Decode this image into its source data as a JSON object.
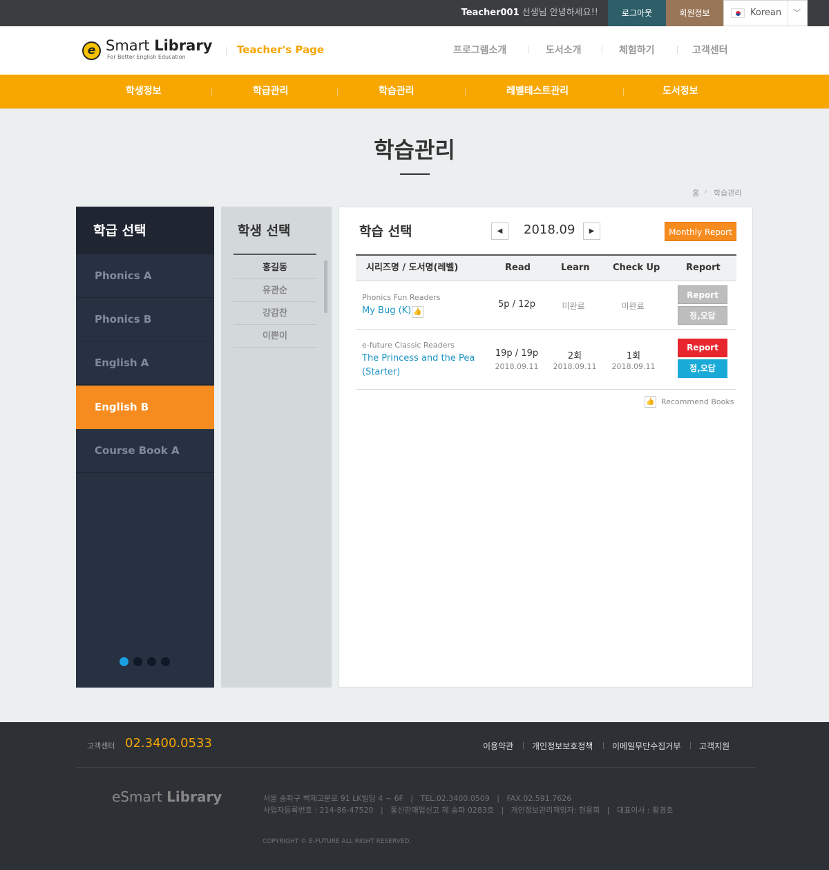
{
  "topbar": {
    "greeting_name": "Teacher001",
    "greeting_suffix": " 선생님 안녕하세요!!",
    "logout": "로그아웃",
    "member_info": "회원정보",
    "language": "Korean"
  },
  "header": {
    "logo_prefix": "Smart",
    "logo_bold": "Library",
    "logo_sub": "For Better English Education",
    "page_label": "Teacher's Page",
    "nav": [
      "프로그램소개",
      "도서소개",
      "체험하기",
      "고객센터"
    ]
  },
  "main_nav": [
    "학생정보",
    "학급관리",
    "학습관리",
    "레벨테스트관리",
    "도서정보"
  ],
  "page": {
    "title": "학습관리",
    "breadcrumb_home": "홈",
    "breadcrumb_current": "학습관리"
  },
  "class_panel": {
    "title": "학급 선택",
    "items": [
      "Phonics A",
      "Phonics B",
      "English A",
      "English B",
      "Course Book A"
    ],
    "active_index": 3,
    "pages": 4,
    "current_page": 1
  },
  "student_panel": {
    "title": "학생 선택",
    "students": [
      "홍길동",
      "유관순",
      "강감찬",
      "이쁜이"
    ],
    "selected_index": 0
  },
  "study_panel": {
    "title": "학습 선택",
    "month": "2018.09",
    "monthly_report": "Monthly Report",
    "headers": [
      "시리즈명 / 도서명(레벨)",
      "Read",
      "Learn",
      "Check Up",
      "Report"
    ],
    "rows": [
      {
        "series": "Phonics Fun Readers",
        "book": "My Bug (K)",
        "read": "5p / 12p",
        "learn": "미완료",
        "check": "미완료",
        "report": "Report",
        "answer": "정,오답"
      },
      {
        "series": "e-future Classic Readers",
        "book_line1": "The Princess and the Pea",
        "book_line2": "(Starter)",
        "read": "19p / 19p",
        "read_date": "2018.09.11",
        "learn": "2회",
        "learn_date": "2018.09.11",
        "check": "1회",
        "check_date": "2018.09.11",
        "report": "Report",
        "answer": "정,오답"
      }
    ],
    "recommend": "Recommend Books"
  },
  "footer": {
    "cs_label": "고객센터",
    "cs_phone": "02.3400.0533",
    "links": [
      "이용약관",
      "개인정보보호정책",
      "이메일무단수집거부",
      "고객지원"
    ],
    "logo_prefix": "eSmart",
    "logo_bold": "Library",
    "info_line1": "서울 송파구 백제고분로 91 LK빌딩 4 ~ 6F   |   TEL.02.3400.0509   |   FAX.02.591.7626",
    "info_line2": "사업자등록번호 : 214-86-47520   |   통신판매업신고 제 송파 0283호   |   개인정보관리책임자: 현용희   |   대표이사 : 황경호",
    "copyright": "COPYRIGHT © E-FUTURE ALL RIGHT RESERVED."
  },
  "colors": {
    "orange": "#f8a700",
    "active_class": "#f68b1f",
    "link_blue": "#1c94c4",
    "report_red": "#e8262d",
    "answer_blue": "#1aaad8"
  }
}
